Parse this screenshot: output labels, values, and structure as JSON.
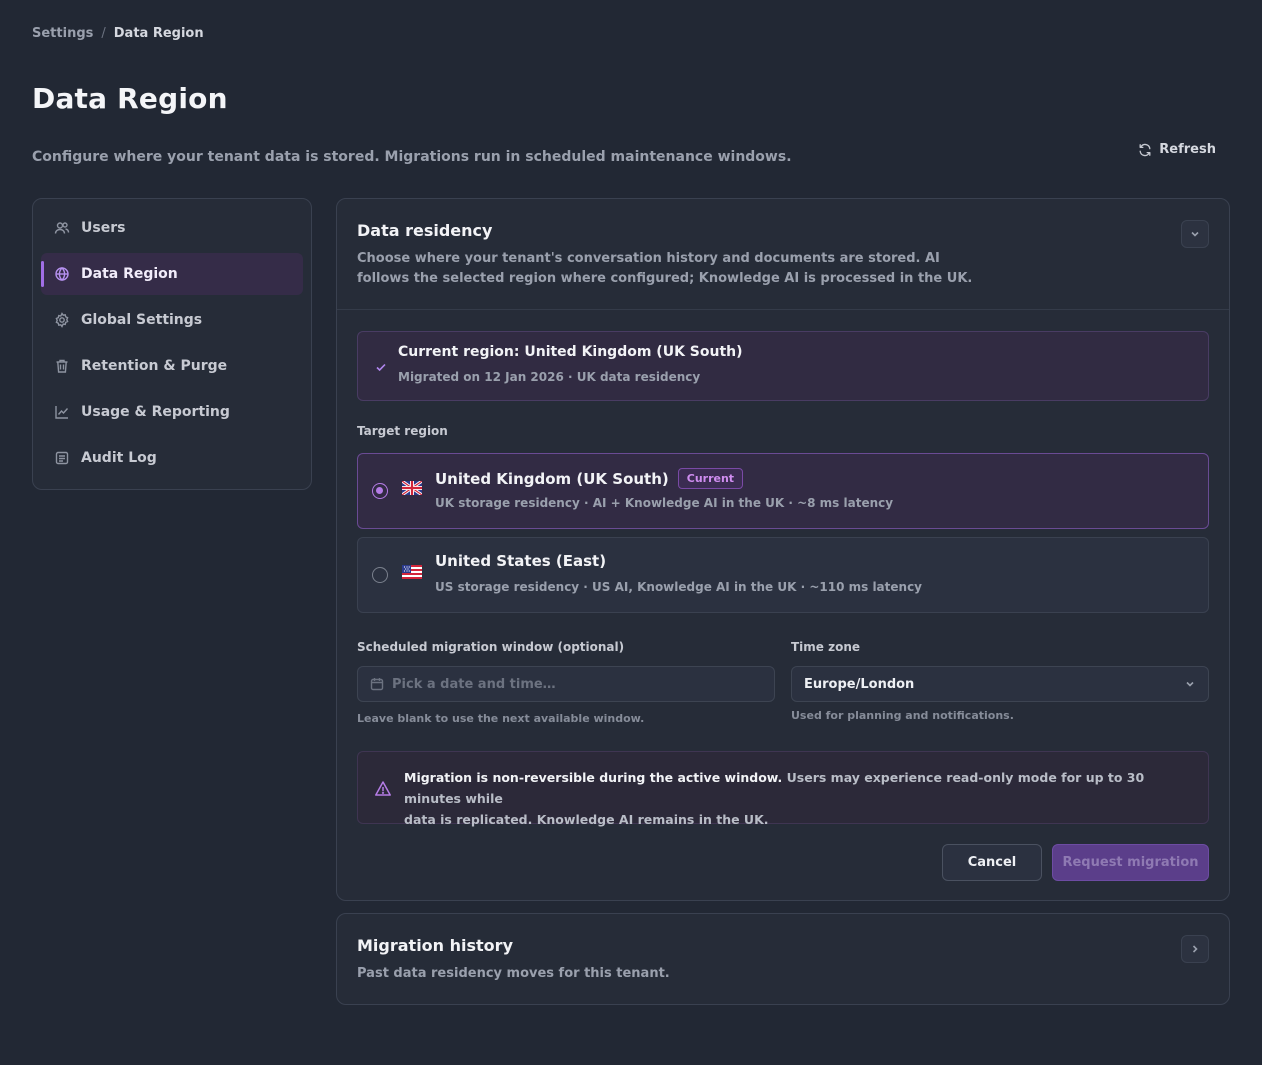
{
  "breadcrumb": {
    "parent": "Settings",
    "separator": "/",
    "current": "Data Region"
  },
  "header": {
    "title": "Data Region",
    "description": "Configure where your tenant data is stored. Migrations run in scheduled maintenance windows.",
    "refresh_label": "Refresh"
  },
  "sidebar": {
    "items": [
      {
        "label": "Users",
        "icon": "users-icon",
        "active": false
      },
      {
        "label": "Data Region",
        "icon": "globe-icon",
        "active": true
      },
      {
        "label": "Global Settings",
        "icon": "gear-icon",
        "active": false
      },
      {
        "label": "Retention & Purge",
        "icon": "trash-icon",
        "active": false
      },
      {
        "label": "Usage & Reporting",
        "icon": "chart-icon",
        "active": false
      },
      {
        "label": "Audit Log",
        "icon": "list-icon",
        "active": false
      }
    ]
  },
  "residency": {
    "title": "Data residency",
    "description_line1": "Choose where your tenant's conversation history and documents are stored. AI",
    "description_line2": "follows the selected region where configured; Knowledge AI is processed in the UK.",
    "current": {
      "title": "Current region: United Kingdom (UK South)",
      "subtitle": "Migrated on 12 Jan 2026 · UK data residency"
    },
    "target_label": "Target region",
    "options": [
      {
        "name": "United Kingdom (UK South)",
        "badge": "Current",
        "meta": "UK storage residency · AI + Knowledge AI in the UK · ~8 ms latency",
        "flag": "uk-flag-icon",
        "selected": true
      },
      {
        "name": "United States (East)",
        "badge": "",
        "meta": "US storage residency · US AI, Knowledge AI in the UK · ~110 ms latency",
        "flag": "us-flag-icon",
        "selected": false
      }
    ],
    "schedule": {
      "label": "Scheduled migration window (optional)",
      "placeholder": "Pick a date and time…",
      "value": "",
      "hint": "Leave blank to use the next available window."
    },
    "timezone": {
      "label": "Time zone",
      "value": "Europe/London",
      "hint": "Used for planning and notifications."
    },
    "warning": {
      "bold": "Migration is non-reversible during the active window.",
      "text_line1": " Users may experience read-only mode for up to 30 minutes while",
      "text_line2": "data is replicated. Knowledge AI remains in the UK."
    },
    "cancel_label": "Cancel",
    "submit_label": "Request migration"
  },
  "history": {
    "title": "Migration history",
    "description": "Past data residency moves for this tenant."
  },
  "colors": {
    "background": "#222834",
    "accent": "#a16ee6",
    "primary_button": "#5b3e8a"
  }
}
